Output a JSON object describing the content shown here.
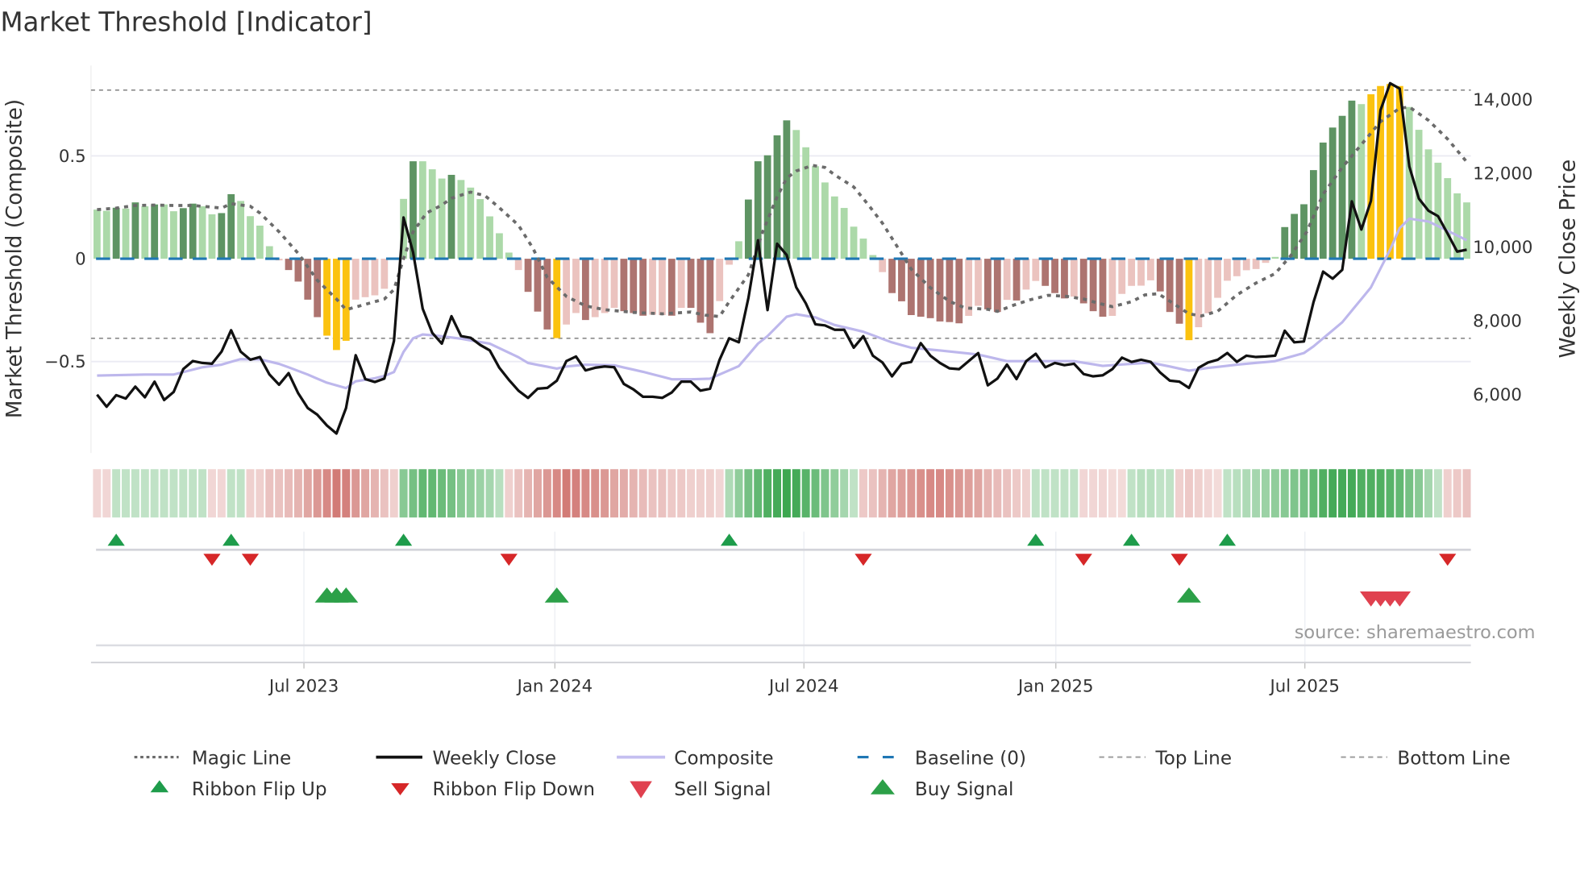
{
  "title": "Market Threshold [Indicator]",
  "source": "source: sharemaestro.com",
  "colors": {
    "pos_strong": "#5e9463",
    "pos_weak": "#acd9a9",
    "neg_strong": "#ad7470",
    "neg_weak": "#ebc3bf",
    "extreme": "#fbc20f",
    "close": "#111111",
    "composite": "#bdb7ec",
    "magic": "#6b6b6b",
    "baseline": "#1f77b4",
    "threshold_lines": "#8a8a8a",
    "ribbon_up": "#2ea043",
    "ribbon_down": "#c9625c",
    "flip_up": "#1e9c4b",
    "flip_down": "#d62728",
    "buy": "#2ca048",
    "sell": "#e0414f"
  },
  "legend": [
    {
      "label": "Magic Line",
      "symbol": "dotted-line"
    },
    {
      "label": "Weekly Close",
      "symbol": "solid-line"
    },
    {
      "label": "Composite",
      "symbol": "solid-line"
    },
    {
      "label": "Baseline (0)",
      "symbol": "dashed-line"
    },
    {
      "label": "Top Line",
      "symbol": "dashed-line"
    },
    {
      "label": "Bottom Line",
      "symbol": "dashed-line"
    },
    {
      "label": "Ribbon Flip Up",
      "symbol": "triangle-up"
    },
    {
      "label": "Ribbon Flip Down",
      "symbol": "triangle-down"
    },
    {
      "label": "Sell Signal",
      "symbol": "triangle-down"
    },
    {
      "label": "Buy Signal",
      "symbol": "triangle-up"
    }
  ],
  "chart_data": {
    "type": "bar",
    "title": "Market Threshold [Indicator]",
    "x_unit": "week index",
    "xlim": [
      -0.63,
      143.43
    ],
    "x_ticks": [
      {
        "label": "Jul 2023",
        "week": 21.6
      },
      {
        "label": "Jan 2024",
        "week": 47.8
      },
      {
        "label": "Jul 2024",
        "week": 73.8
      },
      {
        "label": "Jan 2025",
        "week": 100.1
      },
      {
        "label": "Jul 2025",
        "week": 126.1
      }
    ],
    "ylabel_left": "Market Threshold (Composite)",
    "ylabel_right": "Weekly Close Price",
    "ylim_left": [
      -0.945,
      0.94
    ],
    "ylim_right": [
      4410,
      14930
    ],
    "y_left_ticks": [
      {
        "v": 0.5,
        "label": "0.5"
      },
      {
        "v": 0,
        "label": "0"
      },
      {
        "v": -0.5,
        "label": "−0.5"
      }
    ],
    "y_right_ticks": [
      {
        "v": 14000,
        "label": "14,000"
      },
      {
        "v": 12000,
        "label": "12,000"
      },
      {
        "v": 10000,
        "label": "10,000"
      },
      {
        "v": 8000,
        "label": "8,000"
      },
      {
        "v": 6000,
        "label": "6,000"
      }
    ],
    "top_line": 0.82,
    "bottom_line": -0.387,
    "baseline": 0,
    "threshold_bars": {
      "values": [
        0.239,
        0.233,
        0.248,
        0.244,
        0.274,
        0.255,
        0.264,
        0.264,
        0.231,
        0.246,
        0.268,
        0.255,
        0.216,
        0.222,
        0.314,
        0.281,
        0.207,
        0.161,
        0.061,
        -0.008,
        -0.055,
        -0.111,
        -0.199,
        -0.284,
        -0.374,
        -0.444,
        -0.399,
        -0.199,
        -0.187,
        -0.178,
        -0.146,
        -0.005,
        0.291,
        0.474,
        0.474,
        0.435,
        0.39,
        0.408,
        0.383,
        0.346,
        0.29,
        0.206,
        0.124,
        0.03,
        -0.055,
        -0.161,
        -0.257,
        -0.344,
        -0.386,
        -0.32,
        -0.264,
        -0.298,
        -0.284,
        -0.264,
        -0.239,
        -0.255,
        -0.264,
        -0.277,
        -0.272,
        -0.274,
        -0.277,
        -0.239,
        -0.239,
        -0.311,
        -0.362,
        -0.206,
        -0.029,
        0.085,
        0.288,
        0.474,
        0.503,
        0.6,
        0.673,
        0.626,
        0.542,
        0.45,
        0.371,
        0.303,
        0.247,
        0.156,
        0.098,
        0.018,
        -0.065,
        -0.167,
        -0.207,
        -0.274,
        -0.282,
        -0.289,
        -0.305,
        -0.308,
        -0.314,
        -0.278,
        -0.229,
        -0.246,
        -0.259,
        -0.2,
        -0.203,
        -0.15,
        -0.108,
        -0.132,
        -0.167,
        -0.193,
        -0.184,
        -0.217,
        -0.255,
        -0.282,
        -0.278,
        -0.171,
        -0.132,
        -0.131,
        -0.105,
        -0.159,
        -0.259,
        -0.316,
        -0.396,
        -0.333,
        -0.265,
        -0.19,
        -0.107,
        -0.085,
        -0.056,
        -0.05,
        -0.02,
        0.009,
        0.154,
        0.218,
        0.265,
        0.431,
        0.565,
        0.638,
        0.695,
        0.769,
        0.752,
        0.8,
        0.84,
        0.85,
        0.84,
        0.738,
        0.627,
        0.532,
        0.467,
        0.392,
        0.318,
        0.274
      ],
      "tones": "LLDLDLDLLDDLLDDLLLLLDDDDYYYLLLLLLDLLLDLLLLLLLDDDYLLDLLLDDDLLDLDDDLLLDDDDDLLLLLLLLLLDDDDDDDDLLDDLDLLDDDLDDDLLLLLDDDYLLLLLLLLLDDDDDDDDLYYYYLLLLLLL",
      "tone_legend": {
        "D": "strong",
        "L": "weak",
        "Y": "extreme"
      }
    },
    "weekly_close": [
      5996,
      5668,
      5981,
      5887,
      6214,
      5923,
      6346,
      5850,
      6069,
      6688,
      6907,
      6856,
      6834,
      7162,
      7744,
      7162,
      6943,
      7016,
      6542,
      6266,
      6579,
      6032,
      5632,
      5450,
      5158,
      4940,
      5632,
      7067,
      6418,
      6338,
      6433,
      7453,
      10804,
      9857,
      8327,
      7672,
      7380,
      8123,
      7584,
      7540,
      7344,
      7198,
      6724,
      6397,
      6105,
      5908,
      6156,
      6178,
      6375,
      6907,
      7030,
      6652,
      6724,
      6761,
      6739,
      6287,
      6141,
      5937,
      5937,
      5908,
      6054,
      6346,
      6346,
      6105,
      6156,
      6943,
      7526,
      7417,
      8619,
      10185,
      8291,
      10090,
      9784,
      8909,
      8472,
      7904,
      7875,
      7758,
      7758,
      7270,
      7583,
      7052,
      6869,
      6491,
      6833,
      6884,
      7394,
      7052,
      6855,
      6709,
      6687,
      6906,
      7124,
      6250,
      6432,
      6811,
      6418,
      6906,
      7103,
      6738,
      6855,
      6796,
      6833,
      6556,
      6491,
      6520,
      6687,
      7001,
      6884,
      6943,
      6885,
      6593,
      6375,
      6346,
      6178,
      6725,
      6870,
      6943,
      7125,
      6885,
      7052,
      7016,
      7030,
      7052,
      7730,
      7417,
      7438,
      8509,
      9333,
      9143,
      9384,
      11241,
      10476,
      11256,
      13718,
      14447,
      14301,
      12188,
      11314,
      10986,
      10840,
      10367,
      9879,
      9930
    ],
    "composite_points": [
      [
        0,
        -0.568
      ],
      [
        5,
        -0.563
      ],
      [
        8,
        -0.563
      ],
      [
        11,
        -0.528
      ],
      [
        13,
        -0.515
      ],
      [
        15,
        -0.488
      ],
      [
        17,
        -0.489
      ],
      [
        19,
        -0.511
      ],
      [
        20,
        -0.528
      ],
      [
        22,
        -0.563
      ],
      [
        24,
        -0.603
      ],
      [
        26,
        -0.629
      ],
      [
        27,
        -0.596
      ],
      [
        29,
        -0.581
      ],
      [
        30,
        -0.57
      ],
      [
        31,
        -0.551
      ],
      [
        32,
        -0.453
      ],
      [
        33,
        -0.387
      ],
      [
        34,
        -0.368
      ],
      [
        35.5,
        -0.374
      ],
      [
        38,
        -0.389
      ],
      [
        41,
        -0.413
      ],
      [
        44,
        -0.479
      ],
      [
        45,
        -0.507
      ],
      [
        48,
        -0.534
      ],
      [
        49,
        -0.524
      ],
      [
        51,
        -0.515
      ],
      [
        54,
        -0.518
      ],
      [
        57,
        -0.55
      ],
      [
        60,
        -0.586
      ],
      [
        62,
        -0.586
      ],
      [
        64,
        -0.583
      ],
      [
        67,
        -0.522
      ],
      [
        69,
        -0.413
      ],
      [
        70,
        -0.376
      ],
      [
        72,
        -0.282
      ],
      [
        73,
        -0.27
      ],
      [
        75,
        -0.285
      ],
      [
        77,
        -0.322
      ],
      [
        80,
        -0.355
      ],
      [
        83,
        -0.407
      ],
      [
        85,
        -0.433
      ],
      [
        88,
        -0.446
      ],
      [
        92,
        -0.466
      ],
      [
        95,
        -0.498
      ],
      [
        98,
        -0.498
      ],
      [
        102,
        -0.498
      ],
      [
        105,
        -0.521
      ],
      [
        108,
        -0.511
      ],
      [
        110,
        -0.505
      ],
      [
        112,
        -0.524
      ],
      [
        114,
        -0.544
      ],
      [
        116,
        -0.531
      ],
      [
        119,
        -0.515
      ],
      [
        123,
        -0.498
      ],
      [
        126,
        -0.459
      ],
      [
        127,
        -0.426
      ],
      [
        130,
        -0.309
      ],
      [
        133,
        -0.139
      ],
      [
        135,
        0.044
      ],
      [
        136,
        0.149
      ],
      [
        137,
        0.195
      ],
      [
        139,
        0.181
      ],
      [
        141,
        0.136
      ],
      [
        143,
        0.09
      ]
    ],
    "magic_points": [
      [
        0,
        0.239
      ],
      [
        2,
        0.246
      ],
      [
        4,
        0.259
      ],
      [
        6,
        0.261
      ],
      [
        8,
        0.259
      ],
      [
        10,
        0.259
      ],
      [
        12,
        0.251
      ],
      [
        13,
        0.246
      ],
      [
        14,
        0.268
      ],
      [
        16,
        0.255
      ],
      [
        17,
        0.222
      ],
      [
        19,
        0.131
      ],
      [
        21,
        0.026
      ],
      [
        23,
        -0.105
      ],
      [
        25,
        -0.196
      ],
      [
        26,
        -0.248
      ],
      [
        28,
        -0.222
      ],
      [
        30,
        -0.196
      ],
      [
        31,
        -0.15
      ],
      [
        32,
        0
      ],
      [
        33,
        0.131
      ],
      [
        34.4,
        0.222
      ],
      [
        36,
        0.261
      ],
      [
        37,
        0.294
      ],
      [
        39,
        0.324
      ],
      [
        40.5,
        0.307
      ],
      [
        42,
        0.248
      ],
      [
        44,
        0.163
      ],
      [
        45.5,
        0.052
      ],
      [
        47,
        -0.091
      ],
      [
        49,
        -0.183
      ],
      [
        51,
        -0.229
      ],
      [
        53,
        -0.248
      ],
      [
        56,
        -0.261
      ],
      [
        59,
        -0.268
      ],
      [
        62,
        -0.259
      ],
      [
        63.5,
        -0.274
      ],
      [
        65,
        -0.281
      ],
      [
        66,
        -0.209
      ],
      [
        68,
        -0.078
      ],
      [
        69.5,
        0.131
      ],
      [
        71,
        0.301
      ],
      [
        72,
        0.392
      ],
      [
        73,
        0.427
      ],
      [
        74.7,
        0.454
      ],
      [
        76,
        0.444
      ],
      [
        77,
        0.408
      ],
      [
        79,
        0.349
      ],
      [
        80.5,
        0.264
      ],
      [
        82,
        0.173
      ],
      [
        83.6,
        0.055
      ],
      [
        85,
        -0.05
      ],
      [
        87,
        -0.141
      ],
      [
        89,
        -0.207
      ],
      [
        90.6,
        -0.239
      ],
      [
        93,
        -0.246
      ],
      [
        94,
        -0.256
      ],
      [
        95.7,
        -0.226
      ],
      [
        97.4,
        -0.2
      ],
      [
        99.3,
        -0.178
      ],
      [
        101.3,
        -0.183
      ],
      [
        103,
        -0.196
      ],
      [
        104.6,
        -0.217
      ],
      [
        106,
        -0.233
      ],
      [
        108,
        -0.209
      ],
      [
        109.4,
        -0.176
      ],
      [
        110.8,
        -0.17
      ],
      [
        112.5,
        -0.222
      ],
      [
        114,
        -0.268
      ],
      [
        115.3,
        -0.278
      ],
      [
        117,
        -0.255
      ],
      [
        119,
        -0.176
      ],
      [
        121,
        -0.118
      ],
      [
        123,
        -0.072
      ],
      [
        124.6,
        0.013
      ],
      [
        126.3,
        0.131
      ],
      [
        128,
        0.314
      ],
      [
        130,
        0.444
      ],
      [
        132,
        0.555
      ],
      [
        134,
        0.667
      ],
      [
        136,
        0.732
      ],
      [
        137,
        0.738
      ],
      [
        139,
        0.673
      ],
      [
        141,
        0.582
      ],
      [
        143,
        0.471
      ]
    ],
    "ribbon": [
      -0.15,
      -0.15,
      0.2,
      0.2,
      0.2,
      0.2,
      0.2,
      0.2,
      0.2,
      0.2,
      0.2,
      0.2,
      -0.15,
      -0.15,
      0.2,
      0.2,
      -0.2,
      -0.2,
      -0.3,
      -0.3,
      -0.35,
      -0.4,
      -0.5,
      -0.6,
      -0.7,
      -0.8,
      -0.75,
      -0.6,
      -0.5,
      -0.4,
      -0.3,
      -0.2,
      0.5,
      0.6,
      0.7,
      0.7,
      0.65,
      0.6,
      0.5,
      0.45,
      0.4,
      0.35,
      0.25,
      -0.2,
      -0.3,
      -0.4,
      -0.5,
      -0.6,
      -0.7,
      -0.8,
      -0.75,
      -0.7,
      -0.65,
      -0.6,
      -0.5,
      -0.45,
      -0.4,
      -0.35,
      -0.3,
      -0.3,
      -0.25,
      -0.25,
      -0.2,
      -0.2,
      -0.2,
      -0.15,
      0.3,
      0.45,
      0.6,
      0.7,
      0.8,
      0.85,
      0.9,
      0.85,
      0.75,
      0.65,
      0.55,
      0.45,
      0.35,
      0.2,
      -0.25,
      -0.3,
      -0.4,
      -0.5,
      -0.55,
      -0.6,
      -0.65,
      -0.7,
      -0.7,
      -0.65,
      -0.6,
      -0.55,
      -0.5,
      -0.4,
      -0.35,
      -0.3,
      -0.25,
      -0.2,
      0.2,
      0.2,
      0.2,
      0.2,
      0.2,
      -0.15,
      -0.15,
      -0.15,
      -0.12,
      -0.12,
      0.2,
      0.25,
      0.25,
      0.2,
      0.2,
      -0.2,
      -0.25,
      -0.2,
      -0.15,
      -0.12,
      0.2,
      0.25,
      0.3,
      0.35,
      0.4,
      0.45,
      0.5,
      0.55,
      0.6,
      0.7,
      0.8,
      0.85,
      0.85,
      0.85,
      0.8,
      0.8,
      0.8,
      0.75,
      0.7,
      0.6,
      0.5,
      0.35,
      0.2,
      -0.2,
      -0.25,
      -0.3
    ],
    "ribbon_flip_up": [
      2,
      14,
      32,
      66,
      98,
      108,
      118
    ],
    "ribbon_flip_down": [
      12,
      16,
      43,
      80,
      103,
      113,
      141
    ],
    "buy_signals": [
      24,
      25,
      26,
      48,
      114
    ],
    "sell_signals": [
      133,
      134,
      135,
      136
    ],
    "grid": true,
    "legend_position": "bottom"
  }
}
